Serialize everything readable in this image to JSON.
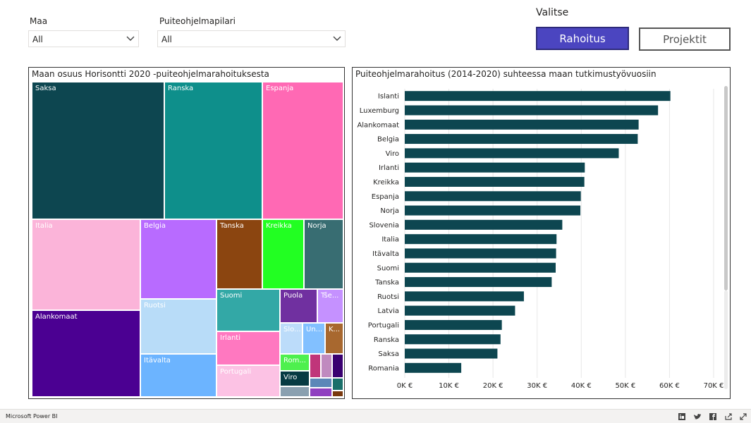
{
  "filters": {
    "maa": {
      "label": "Maa",
      "value": "All"
    },
    "puiteohjelmapilari": {
      "label": "Puiteohjelmapilari",
      "value": "All"
    }
  },
  "toggle": {
    "label": "Valitse",
    "rahoitus": "Rahoitus",
    "projektit": "Projektit"
  },
  "treemap": {
    "title": "Maan osuus Horisontti 2020 -puiteohjelmarahoituksesta",
    "tiles": [
      {
        "label": "Saksa",
        "color": "#0d4650"
      },
      {
        "label": "Ranska",
        "color": "#0e8f8b"
      },
      {
        "label": "Espanja",
        "color": "#ff69b4"
      },
      {
        "label": "Italia",
        "color": "#fbb4d9"
      },
      {
        "label": "Alankomaat",
        "color": "#4b0092"
      },
      {
        "label": "Belgia",
        "color": "#b86bff"
      },
      {
        "label": "Ruotsi",
        "color": "#b8dcf8"
      },
      {
        "label": "Itävalta",
        "color": "#6cb4ff"
      },
      {
        "label": "Tanska",
        "color": "#8b4510"
      },
      {
        "label": "Kreikka",
        "color": "#22ff22"
      },
      {
        "label": "Norja",
        "color": "#386d72"
      },
      {
        "label": "Suomi",
        "color": "#33a8a6"
      },
      {
        "label": "Irlanti",
        "color": "#ff78c0"
      },
      {
        "label": "Portugali",
        "color": "#fcc2e4"
      },
      {
        "label": "Puola",
        "color": "#7030a0"
      },
      {
        "label": "Tše...",
        "color": "#c591ff"
      },
      {
        "label": "Slo...",
        "color": "#bcdcfa"
      },
      {
        "label": "Un...",
        "color": "#82c0ff"
      },
      {
        "label": "K...",
        "color": "#a8682f"
      },
      {
        "label": "Rom...",
        "color": "#4ef04e"
      },
      {
        "label": "Viro",
        "color": "#063a42"
      }
    ],
    "unlabeled_colors": [
      "#c0357a",
      "#c08abf",
      "#3a0070",
      "#1a6f6a",
      "#5c87b8",
      "#9040c0",
      "#8aa0b0",
      "#7a3a10"
    ]
  },
  "chart_data": {
    "type": "bar",
    "orientation": "horizontal",
    "title": "Puiteohjelmarahoitus (2014-2020) suhteessa maan tutkimustyövuosiin",
    "categories": [
      "Islanti",
      "Luxemburg",
      "Alankomaat",
      "Belgia",
      "Viro",
      "Irlanti",
      "Kreikka",
      "Espanja",
      "Norja",
      "Slovenia",
      "Italia",
      "Itävalta",
      "Suomi",
      "Tanska",
      "Ruotsi",
      "Latvia",
      "Portugali",
      "Ranska",
      "Saksa",
      "Romania"
    ],
    "values": [
      60200,
      57400,
      53000,
      52800,
      48500,
      40800,
      40700,
      39900,
      39800,
      35700,
      34400,
      34300,
      34200,
      33300,
      27000,
      25000,
      22000,
      21700,
      21000,
      12800
    ],
    "xlim": [
      0,
      70000
    ],
    "ticks": [
      "0K €",
      "10K €",
      "20K €",
      "30K €",
      "40K €",
      "50K €",
      "60K €",
      "70K €"
    ],
    "bar_color": "#0d4650",
    "grid": true
  },
  "footer": {
    "brand": "Microsoft Power BI"
  }
}
